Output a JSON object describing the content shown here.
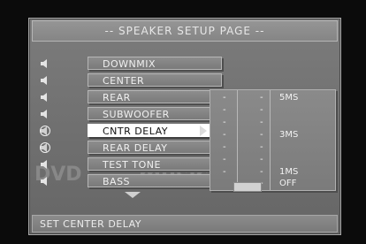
{
  "header": {
    "title": "-- SPEAKER SETUP PAGE --"
  },
  "menu": {
    "items": [
      {
        "label": "DOWNMIX",
        "icon": "speaker-icon",
        "selected": false
      },
      {
        "label": "CENTER",
        "icon": "speaker-icon",
        "selected": false
      },
      {
        "label": "REAR",
        "icon": "speaker-icon",
        "selected": false
      },
      {
        "label": "SUBWOOFER",
        "icon": "speaker-icon",
        "selected": false
      },
      {
        "label": "CNTR DELAY",
        "icon": "speaker-delay-icon",
        "selected": true
      },
      {
        "label": "REAR DELAY",
        "icon": "speaker-delay-icon",
        "selected": false
      },
      {
        "label": "TEST TONE",
        "icon": "speaker-icon",
        "selected": false
      },
      {
        "label": "BASS",
        "icon": "speaker-icon",
        "selected": false
      }
    ]
  },
  "values": {
    "rows": [
      {
        "d1": "-",
        "d2": "-",
        "label": "5MS"
      },
      {
        "d1": "-",
        "d2": "-",
        "label": ""
      },
      {
        "d1": "-",
        "d2": "-",
        "label": ""
      },
      {
        "d1": "-",
        "d2": "-",
        "label": "3MS"
      },
      {
        "d1": "-",
        "d2": "-",
        "label": ""
      },
      {
        "d1": "-",
        "d2": "-",
        "label": ""
      },
      {
        "d1": "-",
        "d2": "-",
        "label": "1MS"
      },
      {
        "d1": "",
        "d2": "-",
        "label": "OFF"
      }
    ]
  },
  "footer": {
    "status": "SET CENTER DELAY"
  },
  "colors": {
    "selected_bg": "#ffffff",
    "panel_bg": "#7a7a7a"
  }
}
